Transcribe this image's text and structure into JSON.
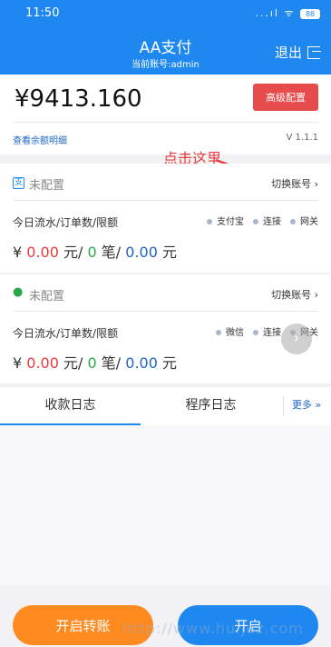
{
  "status_bar": {
    "time": "11:50",
    "signal": "...ıl",
    "wifi": "ᯤ",
    "battery": "88"
  },
  "header": {
    "title": "AA支付",
    "subtitle": "当前账号:admin",
    "logout_label": "退出"
  },
  "balance": {
    "amount": "¥9413.160",
    "advanced_button": "高级配置",
    "detail_link": "查看余额明细",
    "version": "V 1.1.1"
  },
  "annotation": {
    "text": "点击这里",
    "color": "#e83b3b"
  },
  "accounts": [
    {
      "icon": "alipay-icon",
      "icon_glyph": "支",
      "status": "未配置",
      "switch_label": "切换账号 ›",
      "stats_label": "今日流水/订单数/限额",
      "tags": [
        "支付宝",
        "连接",
        "网关"
      ],
      "turnover": "0.00",
      "unit_yuan": "元/",
      "orders": "0",
      "unit_orders": "笔/",
      "limit": "0.00",
      "unit_limit": "元"
    },
    {
      "icon": "wechat-icon",
      "icon_glyph": "●",
      "status": "未配置",
      "switch_label": "切换账号 ›",
      "stats_label": "今日流水/订单数/限额",
      "tags": [
        "微信",
        "连接",
        "网关"
      ],
      "turnover": "0.00",
      "unit_yuan": "元/",
      "orders": "0",
      "unit_orders": "笔/",
      "limit": "0.00",
      "unit_limit": "元"
    }
  ],
  "tabs": {
    "receipt_log": "收款日志",
    "program_log": "程序日志",
    "more": "更多 »"
  },
  "bottom": {
    "transfer_button": "开启转账",
    "start_button": "开启",
    "watermark": "http://www.huijuz.com"
  },
  "colors": {
    "primary": "#1e88f0",
    "danger": "#e74c4c",
    "orange": "#ff8a1f",
    "green": "#2aa84a"
  }
}
